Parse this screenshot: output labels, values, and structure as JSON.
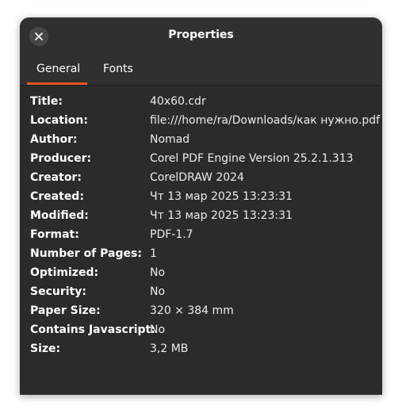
{
  "window": {
    "title": "Properties",
    "accent_color": "#e95420"
  },
  "titlebar": {
    "close_icon": "close-icon"
  },
  "tabs": [
    {
      "label": "General",
      "active": true
    },
    {
      "label": "Fonts",
      "active": false
    }
  ],
  "properties": [
    {
      "label": "Title:",
      "value": "40x60.cdr"
    },
    {
      "label": "Location:",
      "value": "file:///home/ra/Downloads/как нужно.pdf"
    },
    {
      "label": "Author:",
      "value": "Nomad"
    },
    {
      "label": "Producer:",
      "value": "Corel PDF Engine Version 25.2.1.313"
    },
    {
      "label": "Creator:",
      "value": "CorelDRAW 2024"
    },
    {
      "label": "Created:",
      "value": "Чт 13 мар 2025 13:23:31"
    },
    {
      "label": "Modified:",
      "value": "Чт 13 мар 2025 13:23:31"
    },
    {
      "label": "Format:",
      "value": "PDF-1.7"
    },
    {
      "label": "Number of Pages:",
      "value": "1"
    },
    {
      "label": "Optimized:",
      "value": "No"
    },
    {
      "label": "Security:",
      "value": "No"
    },
    {
      "label": "Paper Size:",
      "value": "320 × 384 mm"
    },
    {
      "label": "Contains Javascript:",
      "value": "No"
    },
    {
      "label": "Size:",
      "value": "3,2 MB"
    }
  ]
}
